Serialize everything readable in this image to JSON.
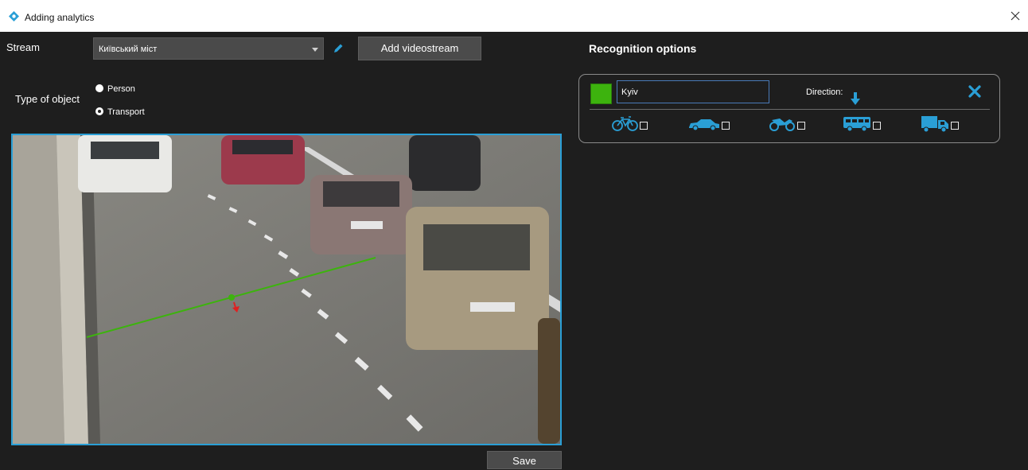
{
  "window": {
    "title": "Adding analytics",
    "close_icon": "close-icon",
    "icon": "app-logo-icon"
  },
  "stream": {
    "label": "Stream",
    "selected": "Київський міст",
    "add_button": "Add videostream"
  },
  "object_type": {
    "label": "Type of object",
    "options": [
      "Person",
      "Transport"
    ],
    "selected": "Transport"
  },
  "footer": {
    "save_button": "Save"
  },
  "recognition": {
    "title": "Recognition options",
    "zone": {
      "color": "#3db30e",
      "name": "Kyiv",
      "direction_label": "Direction:",
      "vehicles": [
        {
          "icon": "bicycle-icon",
          "checked": false
        },
        {
          "icon": "car-icon",
          "checked": false
        },
        {
          "icon": "motorcycle-icon",
          "checked": false
        },
        {
          "icon": "bus-icon",
          "checked": false
        },
        {
          "icon": "truck-icon",
          "checked": false
        }
      ]
    }
  },
  "colors": {
    "accent": "#2a9fd6",
    "line": "#3db30e",
    "direction_marker": "#e02020"
  }
}
